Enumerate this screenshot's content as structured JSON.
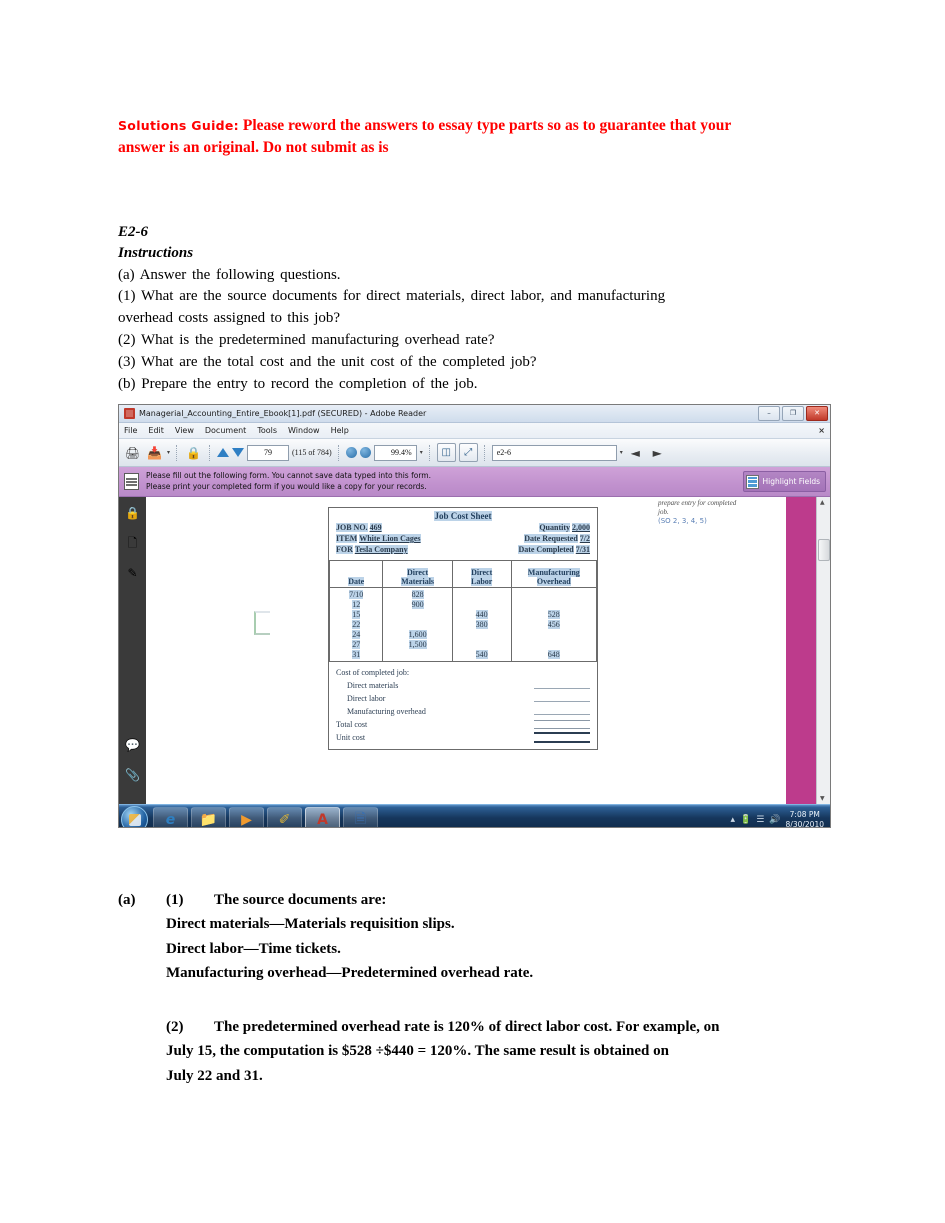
{
  "document": {
    "solutions_guide": {
      "label": "Solutions Guide:",
      "line1": "Please reword the answers to essay type parts so as to guarantee that your",
      "line2": "answer is an original.  Do not submit as is"
    },
    "exercise": {
      "number": "E2-6",
      "instructions_heading": "Instructions",
      "lines": [
        "(a) Answer the following questions.",
        "(1) What are the source documents for direct materials, direct labor, and manufacturing",
        "overhead costs assigned to this job?",
        "(2) What is the predetermined manufacturing overhead rate?",
        "(3) What are the total cost and the unit cost of the completed job?",
        "(b) Prepare the entry to record the completion of the job."
      ]
    },
    "answers": {
      "part_a_label": "(a)",
      "item1_label": "(1)",
      "item1_intro": "The source documents are:",
      "item1_lines": [
        "Direct materials—Materials requisition slips.",
        "Direct labor—Time tickets.",
        "Manufacturing overhead—Predetermined overhead rate."
      ],
      "item2_label": "(2)",
      "item2_lines": [
        "The predetermined overhead rate is 120% of direct labor cost. For example, on",
        "July 15, the computation is $528 ÷$440 = 120%. The same result is obtained on",
        "July 22 and 31."
      ]
    }
  },
  "screenshot": {
    "window": {
      "title": "Managerial_Accounting_Entire_Ebook[1].pdf (SECURED) - Adobe Reader",
      "app_icon": "adobe-acrobat-icon",
      "controls": {
        "minimize": "–",
        "restore": "❐",
        "close": "✕"
      }
    },
    "menubar": {
      "items": [
        "File",
        "Edit",
        "View",
        "Document",
        "Tools",
        "Window",
        "Help"
      ],
      "close_label": "×"
    },
    "toolbar": {
      "print_icon": "printer-icon",
      "email_icon": "share-email-icon",
      "dropdown_caret": "▾",
      "secure_icon": "secure-document-icon",
      "previous_page_icon": "arrow-up-icon",
      "next_page_icon": "arrow-down-icon",
      "page_number": "79",
      "page_count_label": "(115 of 784)",
      "zoom_out_icon": "zoom-out-icon",
      "zoom_in_icon": "zoom-in-icon",
      "zoom_level": "99.4%",
      "zoom_caret": "▾",
      "fit_width_icon": "fit-width-icon",
      "fit_page_icon": "fit-page-icon",
      "search_value": "e2-6",
      "search_caret": "▾",
      "find_previous_icon": "find-previous-icon",
      "find_next_icon": "find-next-icon"
    },
    "formbar": {
      "icon": "form-document-icon",
      "line1": "Please fill out the following form. You cannot save data typed into this form.",
      "line2": "Please print your completed form if you would like a copy for your records.",
      "highlight_button": {
        "icon": "highlight-fields-icon",
        "label": "Highlight Fields"
      }
    },
    "navpane": {
      "items": [
        {
          "icon": "lock-icon",
          "glyph": "🔒"
        },
        {
          "icon": "pages-panel-icon",
          "glyph": "🗋"
        },
        {
          "icon": "signature-icon",
          "glyph": "✎"
        },
        {
          "icon": "comments-icon",
          "glyph": "💬"
        },
        {
          "icon": "attachments-icon",
          "glyph": "📎"
        }
      ]
    },
    "scrollbar": {
      "up_arrow": "▲",
      "down_arrow": "▼"
    },
    "annotation": {
      "line1": "prepare entry for completed",
      "line2": "job.",
      "so_ref": "(SO 2, 3, 4, 5)"
    },
    "job_cost_sheet": {
      "title": "Job Cost Sheet",
      "header": [
        {
          "left_label": "JOB NO.",
          "left_value": "469",
          "right_label": "Quantity",
          "right_value": "2,000"
        },
        {
          "left_label": "ITEM",
          "left_value": "White Lion Cages",
          "right_label": "Date Requested",
          "right_value": "7/2"
        },
        {
          "left_label": "FOR",
          "left_value": "Tesla Company",
          "right_label": "Date Completed",
          "right_value": "7/31"
        }
      ],
      "columns": [
        {
          "line1": "",
          "line2": "Date"
        },
        {
          "line1": "Direct",
          "line2": "Materials"
        },
        {
          "line1": "Direct",
          "line2": "Labor"
        },
        {
          "line1": "Manufacturing",
          "line2": "Overhead"
        }
      ],
      "rows": [
        {
          "date": "7/10",
          "direct_materials": "828",
          "direct_labor": "",
          "manufacturing_overhead": ""
        },
        {
          "date": "12",
          "direct_materials": "900",
          "direct_labor": "",
          "manufacturing_overhead": ""
        },
        {
          "date": "15",
          "direct_materials": "",
          "direct_labor": "440",
          "manufacturing_overhead": "528"
        },
        {
          "date": "22",
          "direct_materials": "",
          "direct_labor": "380",
          "manufacturing_overhead": "456"
        },
        {
          "date": "24",
          "direct_materials": "1,600",
          "direct_labor": "",
          "manufacturing_overhead": ""
        },
        {
          "date": "27",
          "direct_materials": "1,500",
          "direct_labor": "",
          "manufacturing_overhead": ""
        },
        {
          "date": "31",
          "direct_materials": "",
          "direct_labor": "540",
          "manufacturing_overhead": "648"
        }
      ],
      "footer": {
        "heading": "Cost of completed job:",
        "items": [
          {
            "label": "Direct materials",
            "rule": "single"
          },
          {
            "label": "Direct labor",
            "rule": "single"
          },
          {
            "label": "Manufacturing overhead",
            "rule": "single"
          },
          {
            "label": "Total cost",
            "rule": "double"
          },
          {
            "label": "Unit cost",
            "rule": "thick"
          }
        ]
      }
    },
    "taskbar": {
      "start_label": "start-orb",
      "items": [
        {
          "icon": "internet-explorer-icon",
          "glyph": "℮"
        },
        {
          "icon": "windows-explorer-icon",
          "glyph": "🗀"
        },
        {
          "icon": "media-player-icon",
          "glyph": "▶"
        },
        {
          "icon": "paint-icon",
          "glyph": "🖌"
        },
        {
          "icon": "adobe-reader-icon",
          "glyph": "Ⓐ"
        },
        {
          "icon": "word-document-icon",
          "glyph": "🗎"
        }
      ],
      "tray": {
        "show_hidden": "▴",
        "battery_icon": "battery-icon",
        "network_icon": "network-signal-icon",
        "volume_icon": "volume-icon",
        "time": "7:08 PM",
        "date": "8/30/2010"
      }
    }
  },
  "colors": {
    "alert_red": "#FF0000",
    "form_bar_purple": "#c191ce",
    "magenta_block": "#bd3b8c",
    "highlight_blue": "#bcd3e8",
    "taskbar_blue": "#16365c"
  }
}
